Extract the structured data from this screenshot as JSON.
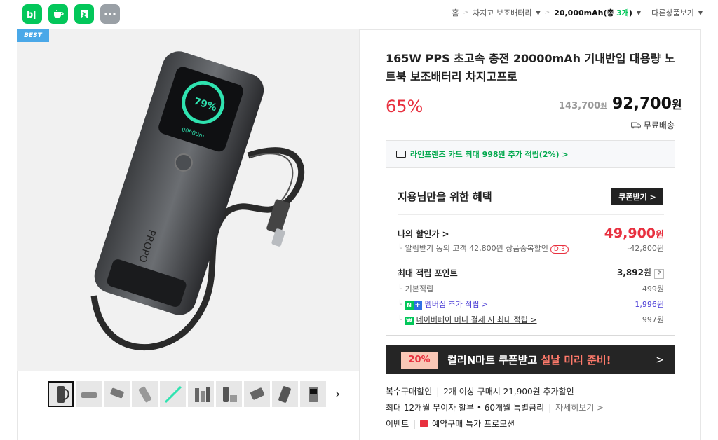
{
  "topbar": {
    "apps": [
      {
        "name": "blog-app-icon",
        "glyph": "b|"
      },
      {
        "name": "cafe-app-icon",
        "glyph": "☕"
      },
      {
        "name": "bookmark-app-icon",
        "glyph": "◣"
      },
      {
        "name": "more-apps-icon",
        "glyph": "···"
      }
    ],
    "breadcrumb": {
      "home": "홈",
      "category": "차지고 보조배터리",
      "capacity": "20,000mAh(총",
      "capacity_count": "3개",
      "capacity_close": ")",
      "other": "다른상품보기"
    }
  },
  "gallery": {
    "best_badge": "BEST",
    "thumb_count": 10
  },
  "product": {
    "title": "165W PPS 초고속 충전 20000mAh 기내반입 대용량 노트북 보조배터리 차지고프로",
    "discount_rate": "65%",
    "original_price": "143,700",
    "original_unit": "원",
    "sale_price": "92,700",
    "sale_unit": "원",
    "shipping": "무료배송",
    "device_screen_percent": "79%",
    "device_screen_time": "00h00m"
  },
  "card_promo": "라인프렌즈 카드 최대 998원 추가 적립(2%) >",
  "benefit": {
    "heading": "지용님만을 위한 혜택",
    "coupon_button": "쿠폰받기 >",
    "my_price_label": "나의 할인가 >",
    "my_price": "49,900",
    "my_price_unit": "원",
    "alarm_text": "알림받기 동의 고객 42,800원 상품중복할인",
    "alarm_badge": "D-3",
    "alarm_amount": "-42,800원",
    "points_label": "최대 적립 포인트",
    "points_value": "3,892",
    "points_unit": "원",
    "points_help": "?",
    "basic_label": "기본적립",
    "basic_value": "499원",
    "membership_label": "멤버십 추가 적립 >",
    "membership_value": "1,996원",
    "npay_label": "네이버페이 머니 결제 시 최대 적립 >",
    "npay_value": "997원"
  },
  "banner": {
    "percent": "20%",
    "text_main": "컬리N마트 쿠폰받고",
    "text_highlight": "설날 미리 준비!",
    "arrow": ">"
  },
  "extra": {
    "multi_label": "복수구매할인",
    "multi_value": "2개 이상 구매시 21,900원 추가할인",
    "install_label": "최대 12개월 무이자 할부 • 60개월 특별금리",
    "install_more": "자세히보기 >",
    "event_label": "이벤트",
    "event_value": "예약구매 특가 프로모션"
  },
  "colors": {
    "naver_green": "#03c75a",
    "discount_red": "#e8303f",
    "best_blue": "#4aa8e8",
    "banner_bg": "#252525"
  }
}
